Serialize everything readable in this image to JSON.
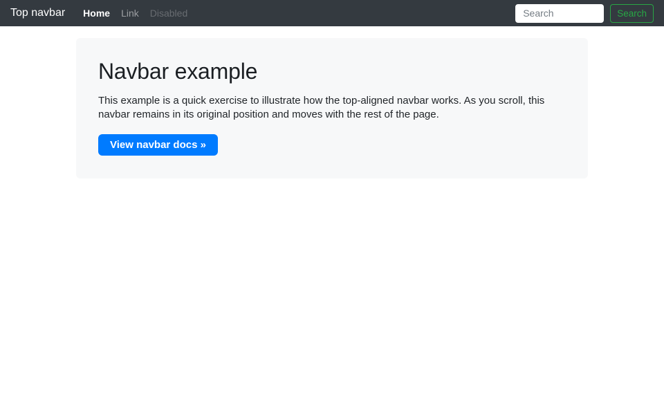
{
  "navbar": {
    "brand": "Top navbar",
    "items": [
      {
        "label": "Home",
        "state": "active"
      },
      {
        "label": "Link",
        "state": "normal"
      },
      {
        "label": "Disabled",
        "state": "disabled"
      }
    ],
    "search": {
      "placeholder": "Search",
      "button_label": "Search"
    }
  },
  "jumbotron": {
    "title": "Navbar example",
    "description": "This example is a quick exercise to illustrate how the top-aligned navbar works. As you scroll, this navbar remains in its original position and moves with the rest of the page.",
    "cta_label": "View navbar docs »"
  },
  "colors": {
    "navbar_bg": "#343a40",
    "success_green": "#28a745",
    "primary_blue": "#007bff",
    "jumbotron_bg": "#f7f8f9"
  }
}
